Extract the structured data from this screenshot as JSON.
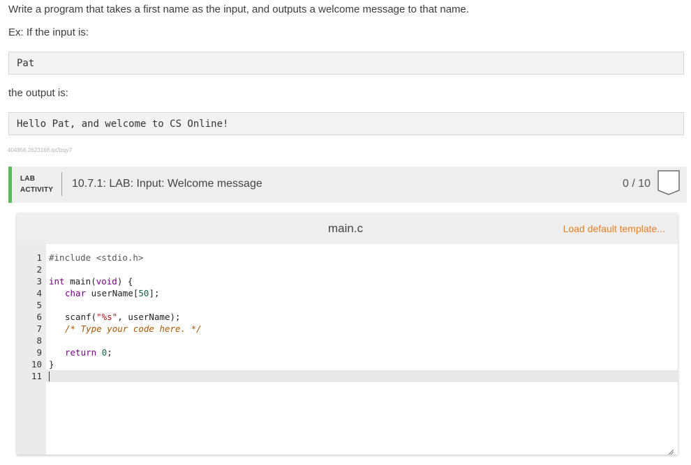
{
  "prompt": {
    "line1": "Write a program that takes a first name as the input, and outputs a welcome message to that name.",
    "line2": "Ex: If the input is:",
    "input_example": "Pat",
    "line3": "the output is:",
    "output_example": "Hello Pat, and welcome to CS Online!",
    "hash": "404956.2623168.qx3zqy7"
  },
  "lab": {
    "tag_line1": "LAB",
    "tag_line2": "ACTIVITY",
    "title": "10.7.1: LAB: Input: Welcome message",
    "score": "0 / 10"
  },
  "editor": {
    "filename": "main.c",
    "load_template": "Load default template...",
    "line_numbers": [
      "1",
      "2",
      "3",
      "4",
      "5",
      "6",
      "7",
      "8",
      "9",
      "10",
      "11"
    ],
    "code": {
      "l1_pp": "#include <stdio.h>",
      "l3_kw": "int",
      "l3_rest": " main(",
      "l3_kw2": "void",
      "l3_end": ") {",
      "l4_kw": "char",
      "l4_rest": " userName[",
      "l4_num": "50",
      "l4_end": "];",
      "l6_start": "scanf(",
      "l6_str": "\"%s\"",
      "l6_end": ", userName);",
      "l7_cm": "/* Type your code here. */",
      "l9_kw": "return",
      "l9_num": "0",
      "l9_end": ";",
      "l10": "}"
    }
  },
  "colors": {
    "accent_green": "#5cb85c",
    "link_orange": "#e67e22"
  }
}
